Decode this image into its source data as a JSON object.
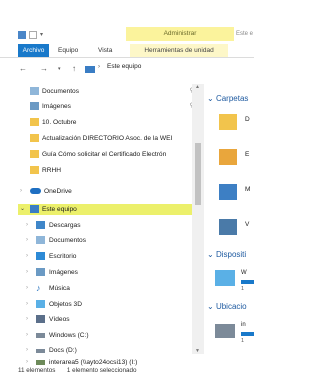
{
  "title_bar": {
    "contextual_label": "Administrar",
    "window_title": "Este e"
  },
  "ribbon": {
    "tabs": [
      "Archivo",
      "Equipo",
      "Vista",
      "Herramientas de unidad"
    ]
  },
  "address_bar": {
    "path": "Este equipo"
  },
  "nav": {
    "quick_access": [
      {
        "label": "Documentos",
        "icon": "documents-icon",
        "pinned": true
      },
      {
        "label": "Imágenes",
        "icon": "pictures-icon",
        "pinned": true
      },
      {
        "label": "10. Octubre",
        "icon": "folder-icon",
        "pinned": false
      },
      {
        "label": "Actualización DIRECTORIO Asoc. de la WEI",
        "icon": "folder-icon",
        "pinned": false
      },
      {
        "label": "Guía Cómo solicitar el Certificado Electrón",
        "icon": "folder-icon",
        "pinned": false
      },
      {
        "label": "RRHH",
        "icon": "folder-icon",
        "pinned": false
      }
    ],
    "onedrive": "OneDrive",
    "this_pc": "Este equipo",
    "this_pc_items": [
      {
        "label": "Descargas",
        "icon": "downloads-icon"
      },
      {
        "label": "Documentos",
        "icon": "documents-icon"
      },
      {
        "label": "Escritorio",
        "icon": "desktop-icon"
      },
      {
        "label": "Imágenes",
        "icon": "pictures-icon"
      },
      {
        "label": "Música",
        "icon": "music-icon"
      },
      {
        "label": "Objetos 3D",
        "icon": "objects3d-icon"
      },
      {
        "label": "Vídeos",
        "icon": "videos-icon"
      },
      {
        "label": "Windows (C:)",
        "icon": "drive-icon"
      },
      {
        "label": "Docs (D:)",
        "icon": "drive-icon"
      },
      {
        "label": "interarea5 (\\\\ayto24ocsi13) (I:)",
        "icon": "network-drive-icon"
      }
    ]
  },
  "content": {
    "folders_header": "Carpetas",
    "devices_header": "Dispositi",
    "network_header": "Ubicacio",
    "folder_letters": [
      "D",
      "E",
      "M",
      "V"
    ],
    "device_letter": "W",
    "network_letter": "in",
    "device_size": "1",
    "network_size": "1"
  },
  "status_bar": {
    "count": "11 elementos",
    "selected": "1 elemento seleccionado"
  },
  "colors": {
    "accent_blue": "#1979ca",
    "selection_yellow": "#ecf06b",
    "contextual_tab": "#fbf39c"
  }
}
